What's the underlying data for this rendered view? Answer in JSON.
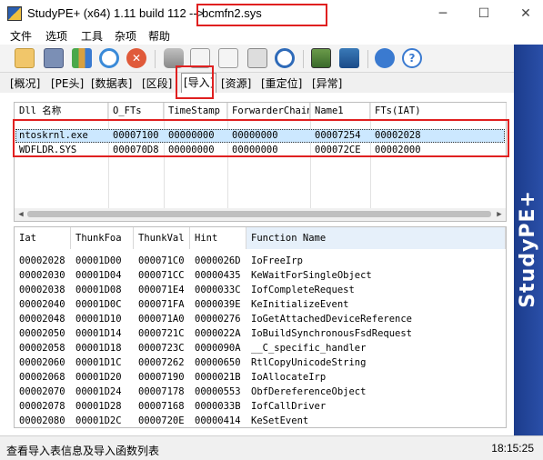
{
  "window": {
    "title": "StudyPE+ (x64) 1.11 build 112",
    "arrow": "-->",
    "file": "bcmfn2.sys",
    "minimize": "─",
    "maximize": "☐",
    "close": "✕"
  },
  "menu": [
    "文件",
    "选项",
    "工具",
    "杂项",
    "帮助"
  ],
  "toolbar_icons": [
    "open-icon",
    "save-icon",
    "chart-icon",
    "refresh-icon",
    "stop-icon",
    "database-icon",
    "doc-icon",
    "doc2-icon",
    "calculator-icon",
    "search-icon",
    "image-icon",
    "disk-icon",
    "settings-icon",
    "help-icon"
  ],
  "tabs": [
    "[概况]",
    "[PE头]",
    "[数据表]",
    "[区段]",
    "[导入]",
    "[资源]",
    "[重定位]",
    "[异常]"
  ],
  "active_tab_index": 4,
  "sidebar_brand": "StudyPE+",
  "dll_table": {
    "headers": [
      "Dll 名称",
      "O_FTs",
      "TimeStamp",
      "ForwarderChain",
      "Name1",
      "FTs(IAT)"
    ],
    "rows": [
      [
        "ntoskrnl.exe",
        "00007100",
        "00000000",
        "00000000",
        "00007254",
        "00002028"
      ],
      [
        "WDFLDR.SYS",
        "000070D8",
        "00000000",
        "00000000",
        "000072CE",
        "00002000"
      ]
    ],
    "selected_row": 0
  },
  "func_table": {
    "headers": [
      "Iat",
      "ThunkFoa",
      "ThunkVal",
      "Hint",
      "Function Name"
    ],
    "rows": [
      [
        "00002028",
        "00001D00",
        "000071C0",
        "0000026D",
        "IoFreeIrp"
      ],
      [
        "00002030",
        "00001D04",
        "000071CC",
        "00000435",
        "KeWaitForSingleObject"
      ],
      [
        "00002038",
        "00001D08",
        "000071E4",
        "0000033C",
        "IofCompleteRequest"
      ],
      [
        "00002040",
        "00001D0C",
        "000071FA",
        "0000039E",
        "KeInitializeEvent"
      ],
      [
        "00002048",
        "00001D10",
        "000071A0",
        "00000276",
        "IoGetAttachedDeviceReference"
      ],
      [
        "00002050",
        "00001D14",
        "0000721C",
        "0000022A",
        "IoBuildSynchronousFsdRequest"
      ],
      [
        "00002058",
        "00001D18",
        "0000723C",
        "0000090A",
        "__C_specific_handler"
      ],
      [
        "00002060",
        "00001D1C",
        "00007262",
        "00000650",
        "RtlCopyUnicodeString"
      ],
      [
        "00002068",
        "00001D20",
        "00007190",
        "0000021B",
        "IoAllocateIrp"
      ],
      [
        "00002070",
        "00001D24",
        "00007178",
        "00000553",
        "ObfDereferenceObject"
      ],
      [
        "00002078",
        "00001D28",
        "00007168",
        "0000033B",
        "IofCallDriver"
      ],
      [
        "00002080",
        "00001D2C",
        "0000720E",
        "00000414",
        "KeSetEvent"
      ]
    ]
  },
  "status": {
    "message": "查看导入表信息及导入函数列表",
    "time": "18:15:25"
  },
  "colors": {
    "highlight_box": "#e02020",
    "selected_row": "#cce8ff",
    "sidebar": "#1c3c8c"
  }
}
